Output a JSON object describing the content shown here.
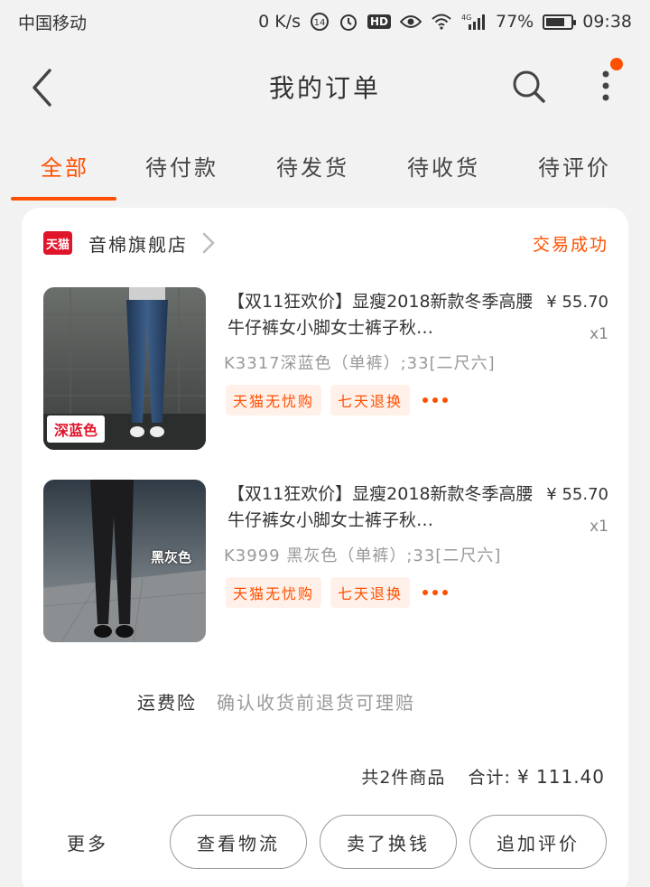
{
  "status_bar": {
    "carrier": "中国移动",
    "net_speed": "0 K/s",
    "hd": "HD",
    "net_type": "4G",
    "battery": "77%",
    "battery_level": 0.77,
    "time": "09:38"
  },
  "header": {
    "title": "我的订单"
  },
  "tabs": [
    {
      "label": "全部",
      "active": true
    },
    {
      "label": "待付款",
      "active": false
    },
    {
      "label": "待发货",
      "active": false
    },
    {
      "label": "待收货",
      "active": false
    },
    {
      "label": "待评价",
      "active": false
    }
  ],
  "order": {
    "shop_logo": "天猫",
    "shop_name": "音棉旗舰店",
    "status": "交易成功",
    "items": [
      {
        "title": "【双11狂欢价】显瘦2018新款冬季高腰牛仔裤女小脚女士裤子秋…",
        "price": "¥ 55.70",
        "qty": "x1",
        "sku": "K3317深蓝色（单裤）;33[二尺六]",
        "thumb_label": "深蓝色",
        "tags": [
          "天猫无忧购",
          "七天退换"
        ]
      },
      {
        "title": "【双11狂欢价】显瘦2018新款冬季高腰牛仔裤女小脚女士裤子秋…",
        "price": "¥ 55.70",
        "qty": "x1",
        "sku": "K3999 黑灰色（单裤）;33[二尺六]",
        "thumb_label": "黑灰色",
        "tags": [
          "天猫无忧购",
          "七天退换"
        ]
      }
    ],
    "insurance_label": "运费险",
    "insurance_desc": "确认收货前退货可理赔",
    "total_count": "共2件商品",
    "total_label": "合计:",
    "total_amount": "¥ 111.40"
  },
  "actions": {
    "more": "更多",
    "logistics": "查看物流",
    "resell": "卖了换钱",
    "review": "追加评价"
  },
  "colors": {
    "accent": "#ff5000",
    "tmall_red": "#e0142a"
  }
}
